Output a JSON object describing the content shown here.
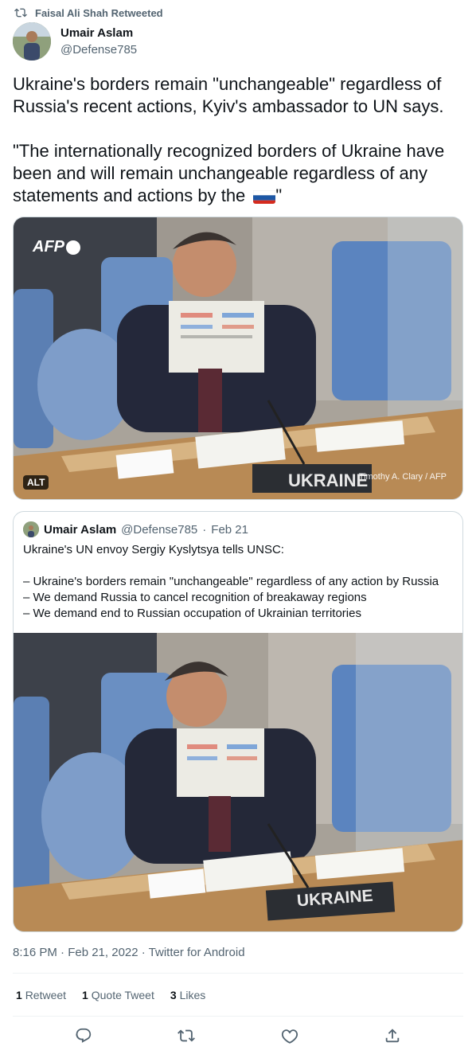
{
  "social_context": {
    "text": "Faisal Ali Shah Retweeted",
    "icon": "retweet-icon"
  },
  "author": {
    "name": "Umair Aslam",
    "handle": "@Defense785"
  },
  "tweet": {
    "text": "Ukraine's borders remain \"unchangeable\" regardless of Russia's recent actions, Kyiv's ambassador to UN says.\n\n\"The internationally recognized borders of Ukraine have been and will remain unchangeable regardless of any statements and actions by the ",
    "text_end": "\"",
    "flag_emoji": "russia-flag"
  },
  "media": {
    "watermark": "AFP",
    "alt_badge": "ALT",
    "credit": "Timothy A. Clary / AFP",
    "nameplate": "UKRAINE"
  },
  "quoted_tweet": {
    "name": "Umair Aslam",
    "handle": "@Defense785",
    "separator": "·",
    "date": "Feb 21",
    "text": "Ukraine's UN envoy Sergiy Kyslytsya tells UNSC:\n\n– Ukraine's borders remain \"unchangeable\" regardless of any action by Russia\n– We demand Russia to cancel recognition of breakaway regions\n– We demand end to Russian occupation of Ukrainian territories",
    "nameplate": "UKRAINE"
  },
  "meta": {
    "timestamp": "8:16 PM · Feb 21, 2022 · Twitter for Android"
  },
  "stats": {
    "retweets_count": "1",
    "retweets_label": "Retweet",
    "quotes_count": "1",
    "quotes_label": "Quote Tweet",
    "likes_count": "3",
    "likes_label": "Likes"
  },
  "actions": [
    "reply-icon",
    "retweet-icon",
    "like-icon",
    "share-icon"
  ],
  "colors": {
    "text": "#0f1419",
    "secondary": "#536471",
    "border": "#cfd9de",
    "divider": "#eff3f4"
  }
}
